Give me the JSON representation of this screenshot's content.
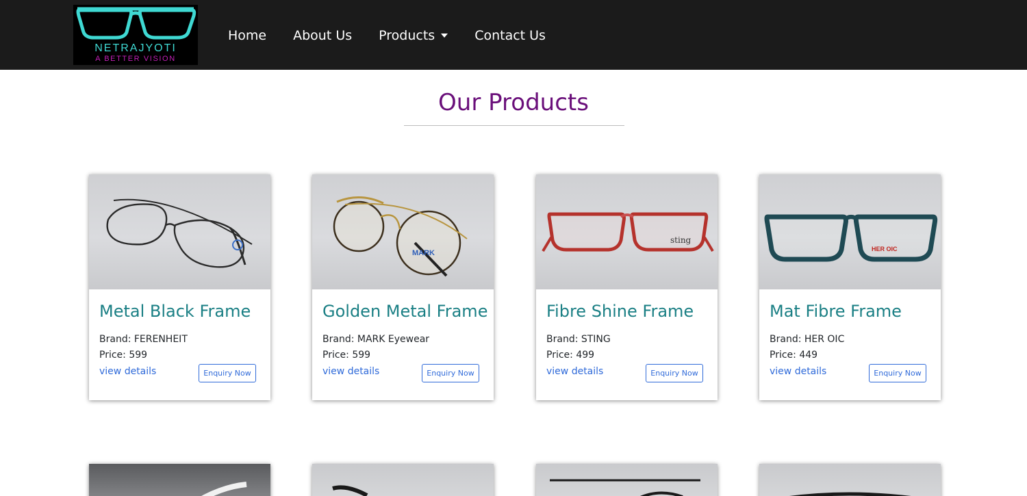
{
  "header": {
    "logo": {
      "name": "NETRAJYOTI",
      "tagline": "A BETTER VISION",
      "icon": "eyeglasses-icon"
    },
    "nav": [
      {
        "label": "Home"
      },
      {
        "label": "About Us"
      },
      {
        "label": "Products",
        "has_dropdown": true
      },
      {
        "label": "Contact Us"
      }
    ]
  },
  "main": {
    "title": "Our Products",
    "products": [
      {
        "name": "Metal Black Frame",
        "brand": "Brand: FERENHEIT",
        "price": "Price: 599",
        "link": "view details",
        "button": "Enquiry Now",
        "image": "metal-black-glasses"
      },
      {
        "name": "Golden Metal Frame",
        "brand": "Brand: MARK Eyewear",
        "price": "Price: 599",
        "link": "view details",
        "button": "Enquiry Now",
        "image": "golden-metal-glasses"
      },
      {
        "name": "Fibre Shine Frame",
        "brand": "Brand: STING",
        "price": "Price: 499",
        "link": "view details",
        "button": "Enquiry Now",
        "image": "red-fibre-glasses"
      },
      {
        "name": "Mat Fibre Frame",
        "brand": "Brand: HER OIC",
        "price": "Price: 449",
        "link": "view details",
        "button": "Enquiry Now",
        "image": "blue-mat-fibre-glasses"
      }
    ],
    "next_row_images": [
      "white-frame-glasses",
      "black-frame-glasses",
      "black-round-glasses",
      "black-frame-glasses"
    ]
  },
  "colors": {
    "navbar": "#1b1b1b",
    "title": "#6a0f7a",
    "product_title": "#1a7f84",
    "link": "#2f6ad9",
    "logo_cyan": "#3fd9d3",
    "logo_magenta": "#c41fb8"
  }
}
